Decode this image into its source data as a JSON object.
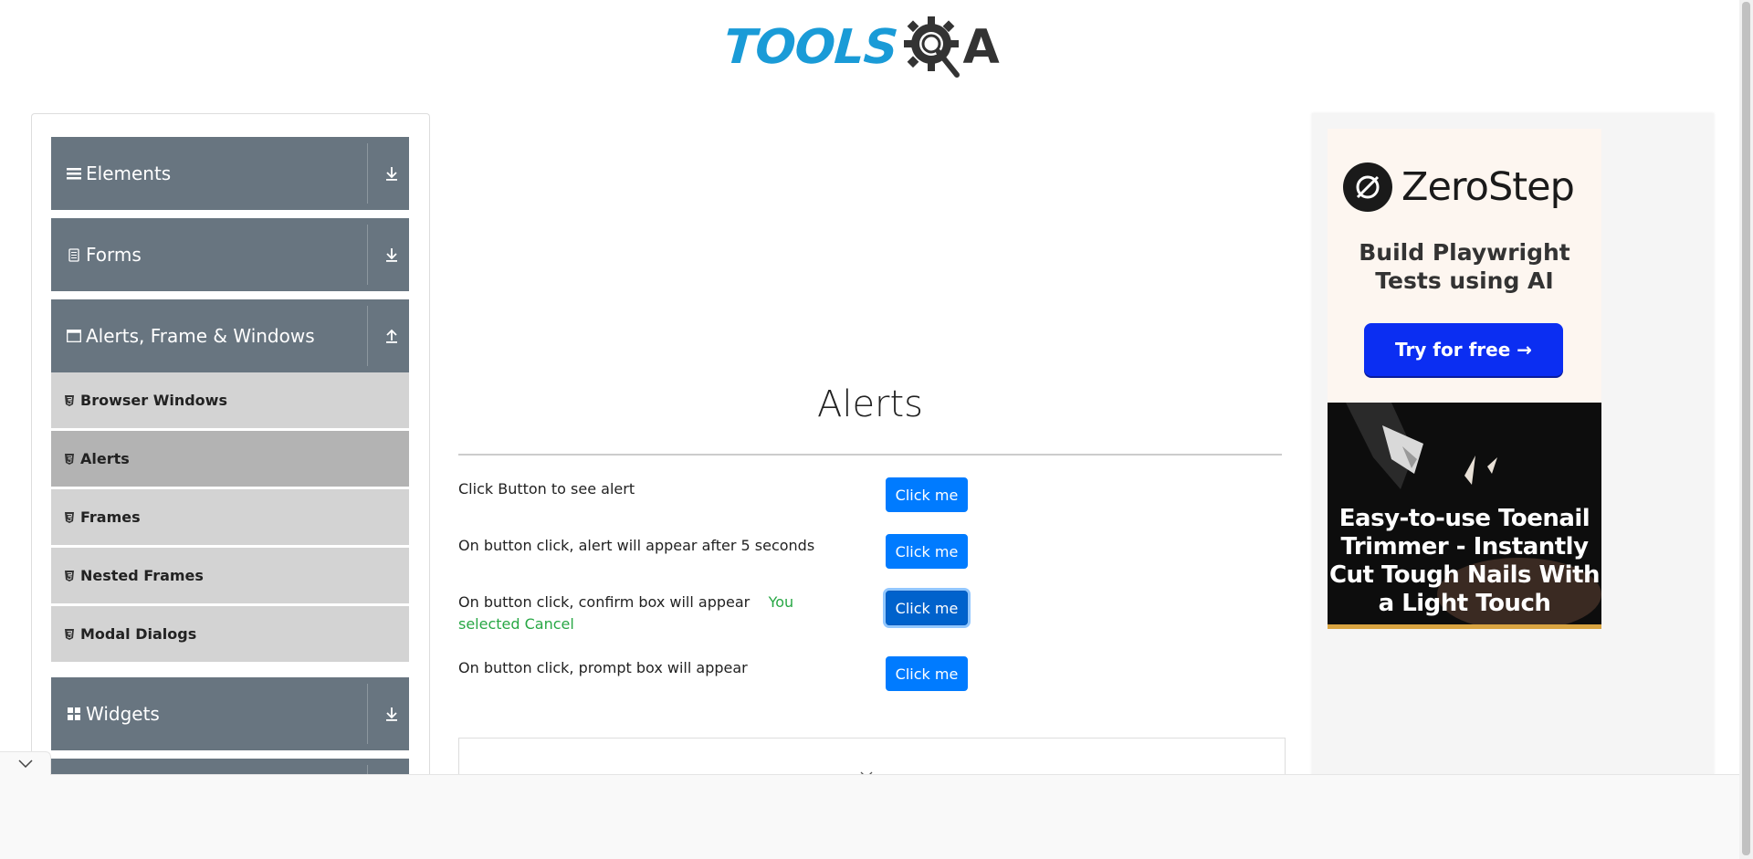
{
  "header": {
    "logo_text": "TOOLS",
    "logo_suffix": "A"
  },
  "sidebar": {
    "groups": [
      {
        "label": "Elements",
        "icon": "hamburger-icon",
        "arrow": "download-arrow-icon"
      },
      {
        "label": "Forms",
        "icon": "document-icon",
        "arrow": "download-arrow-icon"
      },
      {
        "label": "Alerts, Frame & Windows",
        "icon": "window-icon",
        "arrow": "upload-arrow-icon"
      },
      {
        "label": "Widgets",
        "icon": "grid-icon",
        "arrow": "download-arrow-icon"
      }
    ],
    "items": [
      {
        "label": "Browser Windows"
      },
      {
        "label": "Alerts"
      },
      {
        "label": "Frames"
      },
      {
        "label": "Nested Frames"
      },
      {
        "label": "Modal Dialogs"
      }
    ],
    "active_item": "Alerts"
  },
  "main": {
    "title": "Alerts",
    "rows": [
      {
        "label": "Click Button to see alert",
        "button": "Click me"
      },
      {
        "label": "On button click, alert will appear after 5 seconds",
        "button": "Click me"
      },
      {
        "label": "On button click, confirm box will appear",
        "result": "You selected Cancel",
        "button": "Click me"
      },
      {
        "label": "On button click, prompt box will appear",
        "button": "Click me"
      }
    ]
  },
  "ads": {
    "zerostep": {
      "name": "ZeroStep",
      "tagline": "Build Playwright Tests using AI",
      "cta": "Try for free →"
    },
    "toenail": {
      "text": "Easy-to-use Toenail Trimmer - Instantly Cut Tough Nails With a Light Touch"
    }
  },
  "colors": {
    "primary_button": "#007bff",
    "sidebar_group": "#687580",
    "result_text": "#28a745",
    "logo_blue": "#1a9bd7"
  }
}
